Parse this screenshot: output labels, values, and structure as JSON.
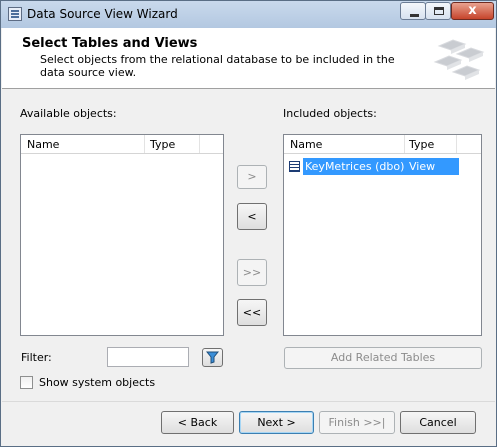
{
  "window": {
    "title": "Data Source View Wizard",
    "close_glyph": "x"
  },
  "header": {
    "title": "Select Tables and Views",
    "subtitle": "Select objects from the relational database to be included in the data source view."
  },
  "available": {
    "label": "Available objects:",
    "columns": [
      "Name",
      "Type"
    ],
    "rows": []
  },
  "included": {
    "label": "Included objects:",
    "columns": [
      "Name",
      "Type"
    ],
    "rows": [
      {
        "name": "KeyMetrices (dbo)",
        "type": "View",
        "selected": true,
        "icon": "table-icon"
      }
    ]
  },
  "transfer_buttons": {
    "add": ">",
    "remove": "<",
    "add_all": ">>",
    "remove_all": "<<"
  },
  "filter": {
    "label": "Filter:",
    "value": "",
    "icon": "filter-icon"
  },
  "add_related": {
    "label": "Add Related Tables"
  },
  "show_system": {
    "label": "Show system objects",
    "checked": false
  },
  "footer": {
    "back": "< Back",
    "next": "Next >",
    "finish": "Finish >>|",
    "cancel": "Cancel"
  },
  "colors": {
    "selection": "#3399ff",
    "titlebar": "#c9d9ec"
  }
}
